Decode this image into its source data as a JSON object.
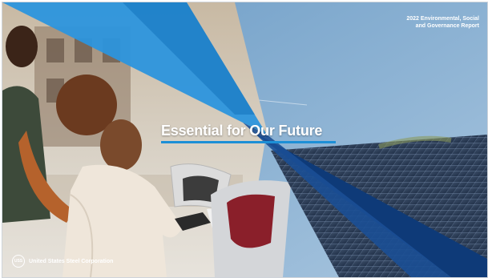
{
  "report": {
    "line1": "2022 Environmental, Social",
    "line2": "and Governance Report"
  },
  "headline": "Essential for Our Future",
  "brand": {
    "logo_text": "USS",
    "name": "United States Steel Corporation"
  },
  "colors": {
    "accent_blue": "#1d8fd6",
    "navy": "#0e3a78",
    "sky": "#7aa8cf"
  }
}
